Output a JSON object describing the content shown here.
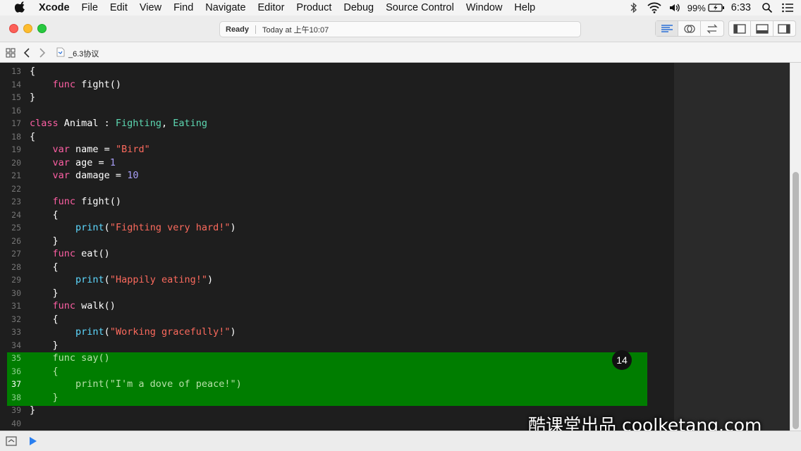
{
  "menubar": {
    "items": [
      "Xcode",
      "File",
      "Edit",
      "View",
      "Find",
      "Navigate",
      "Editor",
      "Product",
      "Debug",
      "Source Control",
      "Window",
      "Help"
    ],
    "battery": "99%",
    "time": "6:33"
  },
  "toolbar": {
    "status": "Ready",
    "status_time": "Today at 上午10:07"
  },
  "jumpbar": {
    "file": "_6.3协议"
  },
  "editor": {
    "lines": [
      {
        "n": "13",
        "parts": [
          {
            "t": "{"
          }
        ]
      },
      {
        "n": "14",
        "parts": [
          {
            "t": "    "
          },
          {
            "t": "func",
            "c": "kw"
          },
          {
            "t": " fight()"
          }
        ]
      },
      {
        "n": "15",
        "parts": [
          {
            "t": "}"
          }
        ]
      },
      {
        "n": "16",
        "parts": []
      },
      {
        "n": "17",
        "parts": [
          {
            "t": "class",
            "c": "kw"
          },
          {
            "t": " Animal : "
          },
          {
            "t": "Fighting",
            "c": "ty"
          },
          {
            "t": ", "
          },
          {
            "t": "Eating",
            "c": "ty"
          }
        ]
      },
      {
        "n": "18",
        "parts": [
          {
            "t": "{"
          }
        ]
      },
      {
        "n": "19",
        "parts": [
          {
            "t": "    "
          },
          {
            "t": "var",
            "c": "kw"
          },
          {
            "t": " name = "
          },
          {
            "t": "\"Bird\"",
            "c": "str"
          }
        ]
      },
      {
        "n": "20",
        "parts": [
          {
            "t": "    "
          },
          {
            "t": "var",
            "c": "kw"
          },
          {
            "t": " age = "
          },
          {
            "t": "1",
            "c": "num"
          }
        ]
      },
      {
        "n": "21",
        "parts": [
          {
            "t": "    "
          },
          {
            "t": "var",
            "c": "kw"
          },
          {
            "t": " damage = "
          },
          {
            "t": "10",
            "c": "num"
          }
        ]
      },
      {
        "n": "22",
        "parts": []
      },
      {
        "n": "23",
        "parts": [
          {
            "t": "    "
          },
          {
            "t": "func",
            "c": "kw"
          },
          {
            "t": " fight()"
          }
        ]
      },
      {
        "n": "24",
        "parts": [
          {
            "t": "    {"
          }
        ]
      },
      {
        "n": "25",
        "parts": [
          {
            "t": "        "
          },
          {
            "t": "print",
            "c": "fn"
          },
          {
            "t": "("
          },
          {
            "t": "\"Fighting very hard!\"",
            "c": "str"
          },
          {
            "t": ")"
          }
        ]
      },
      {
        "n": "26",
        "parts": [
          {
            "t": "    }"
          }
        ]
      },
      {
        "n": "27",
        "parts": [
          {
            "t": "    "
          },
          {
            "t": "func",
            "c": "kw"
          },
          {
            "t": " eat()"
          }
        ]
      },
      {
        "n": "28",
        "parts": [
          {
            "t": "    {"
          }
        ]
      },
      {
        "n": "29",
        "parts": [
          {
            "t": "        "
          },
          {
            "t": "print",
            "c": "fn"
          },
          {
            "t": "("
          },
          {
            "t": "\"Happily eating!\"",
            "c": "str"
          },
          {
            "t": ")"
          }
        ]
      },
      {
        "n": "30",
        "parts": [
          {
            "t": "    }"
          }
        ]
      },
      {
        "n": "31",
        "parts": [
          {
            "t": "    "
          },
          {
            "t": "func",
            "c": "kw"
          },
          {
            "t": " walk()"
          }
        ]
      },
      {
        "n": "32",
        "parts": [
          {
            "t": "    {"
          }
        ]
      },
      {
        "n": "33",
        "parts": [
          {
            "t": "        "
          },
          {
            "t": "print",
            "c": "fn"
          },
          {
            "t": "("
          },
          {
            "t": "\"Working gracefully!\"",
            "c": "str"
          },
          {
            "t": ")"
          }
        ]
      },
      {
        "n": "34",
        "parts": [
          {
            "t": "    }"
          }
        ]
      },
      {
        "n": "35",
        "parts": [
          {
            "t": "    func say()"
          }
        ]
      },
      {
        "n": "36",
        "parts": [
          {
            "t": "    {"
          }
        ]
      },
      {
        "n": "37",
        "parts": [
          {
            "t": "        print(\"I'm a dove of peace!\")"
          }
        ]
      },
      {
        "n": "38",
        "parts": [
          {
            "t": "    }"
          }
        ]
      },
      {
        "n": "39",
        "parts": [
          {
            "t": "}"
          }
        ]
      },
      {
        "n": "40",
        "parts": []
      }
    ],
    "highlight_badge": "14"
  },
  "watermark": "酷课堂出品 coolketang.com",
  "colors": {
    "keyword": "#fc5fa3",
    "type": "#5dd8b2",
    "string": "#fc6a5d",
    "number": "#a79df6",
    "function": "#5dd8ff",
    "highlight": "#007d00",
    "accent": "#2a6fd6"
  },
  "icons": [
    "apple-icon",
    "wifi-icon",
    "volume-icon",
    "battery-icon",
    "spotlight-icon",
    "notification-center-icon",
    "standard-editor-icon",
    "assistant-editor-icon",
    "version-editor-icon",
    "navigator-toggle-icon",
    "debug-area-toggle-icon",
    "utilities-toggle-icon",
    "related-items-icon",
    "back-icon",
    "forward-icon",
    "swift-file-icon",
    "hide-debug-area-icon",
    "run-icon"
  ]
}
